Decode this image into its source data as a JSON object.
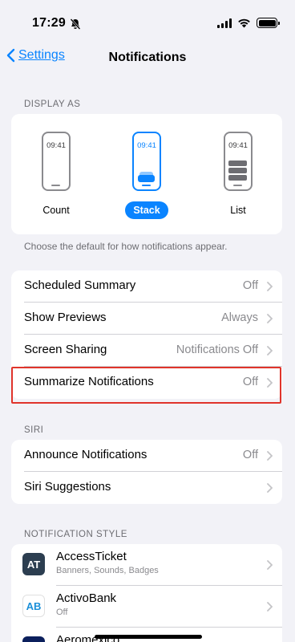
{
  "status_bar": {
    "time": "17:29"
  },
  "nav": {
    "back_label": "Settings",
    "title": "Notifications"
  },
  "display_as": {
    "header": "DISPLAY AS",
    "phone_time": "09:41",
    "options": [
      {
        "label": "Count",
        "selected": false
      },
      {
        "label": "Stack",
        "selected": true
      },
      {
        "label": "List",
        "selected": false
      }
    ],
    "footnote": "Choose the default for how notifications appear."
  },
  "settings_group": [
    {
      "title": "Scheduled Summary",
      "value": "Off"
    },
    {
      "title": "Show Previews",
      "value": "Always"
    },
    {
      "title": "Screen Sharing",
      "value": "Notifications Off"
    },
    {
      "title": "Summarize Notifications",
      "value": "Off"
    }
  ],
  "siri": {
    "header": "SIRI",
    "rows": [
      {
        "title": "Announce Notifications",
        "value": "Off"
      },
      {
        "title": "Siri Suggestions",
        "value": ""
      }
    ]
  },
  "notification_style": {
    "header": "NOTIFICATION STYLE",
    "apps": [
      {
        "name": "AccessTicket",
        "subtitle": "Banners, Sounds, Badges",
        "icon_text": "AT",
        "icon_bg": "#2c3e50",
        "icon_fg": "#ffffff"
      },
      {
        "name": "ActivoBank",
        "subtitle": "Off",
        "icon_text": "AB",
        "icon_bg": "#ffffff",
        "icon_fg": "#1a8fd8"
      },
      {
        "name": "Aeromexico",
        "subtitle": "",
        "icon_text": "",
        "icon_bg": "#0b1f5c",
        "icon_fg": "#ffffff"
      }
    ]
  },
  "colors": {
    "accent": "#0a84ff",
    "highlight": "#e0342b"
  }
}
